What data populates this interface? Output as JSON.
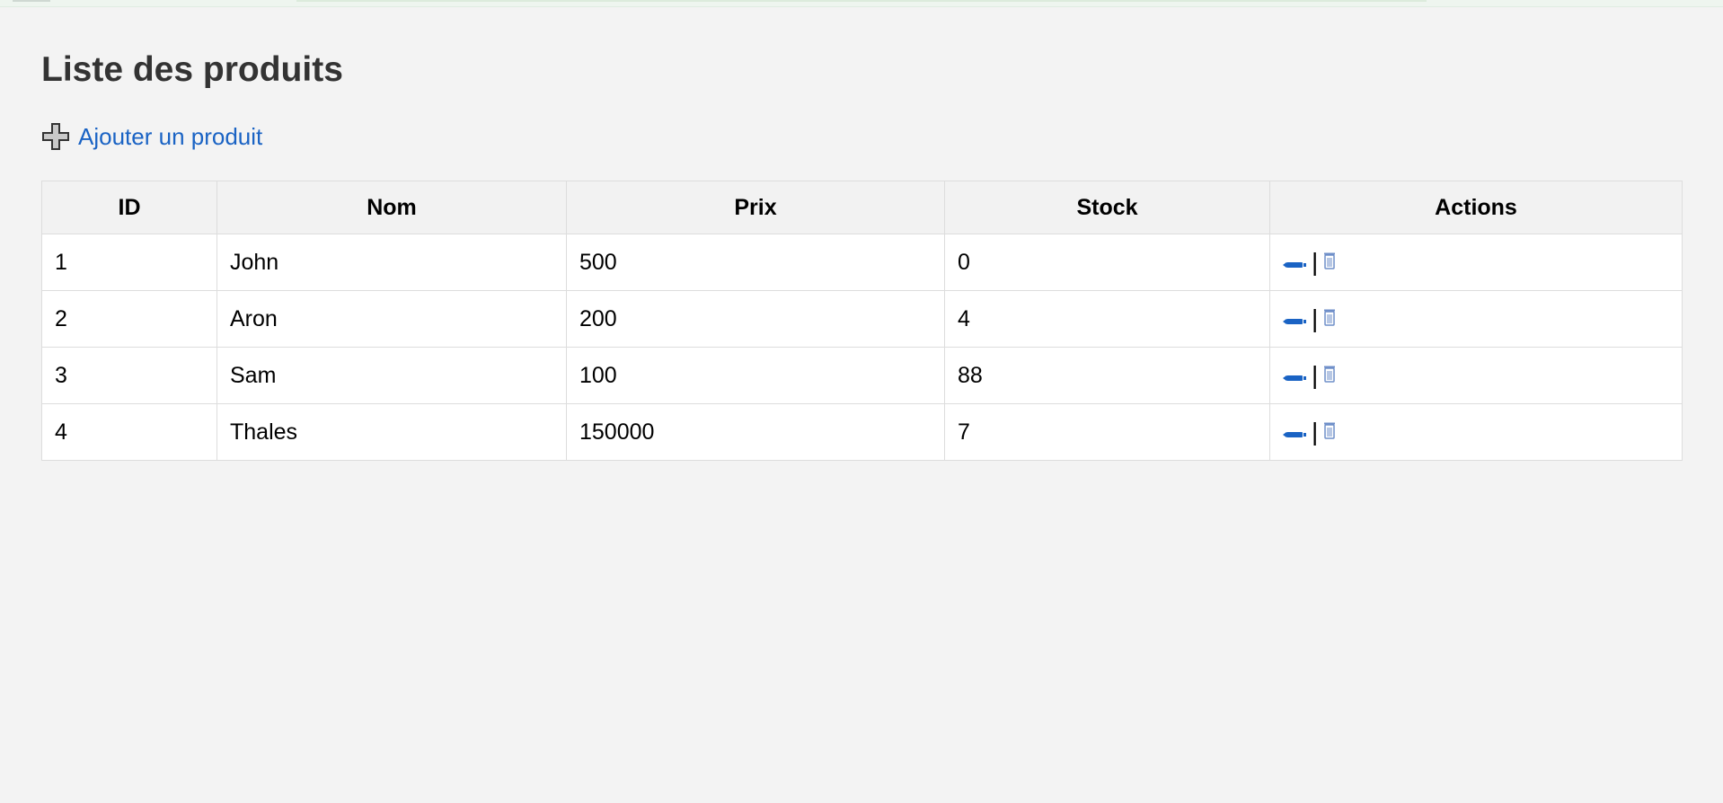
{
  "page": {
    "title": "Liste des produits",
    "add_link_label": "Ajouter un produit"
  },
  "table": {
    "headers": [
      "ID",
      "Nom",
      "Prix",
      "Stock",
      "Actions"
    ],
    "rows": [
      {
        "id": "1",
        "nom": "John",
        "prix": "500",
        "stock": "0"
      },
      {
        "id": "2",
        "nom": "Aron",
        "prix": "200",
        "stock": "4"
      },
      {
        "id": "3",
        "nom": "Sam",
        "prix": "100",
        "stock": "88"
      },
      {
        "id": "4",
        "nom": "Thales",
        "prix": "150000",
        "stock": "7"
      }
    ],
    "action_separator": "|"
  },
  "icons": {
    "add": "plus-icon",
    "edit": "pencil-icon",
    "delete": "trash-icon"
  },
  "colors": {
    "link": "#1a63c4",
    "title": "#333333",
    "background": "#f3f3f3"
  }
}
